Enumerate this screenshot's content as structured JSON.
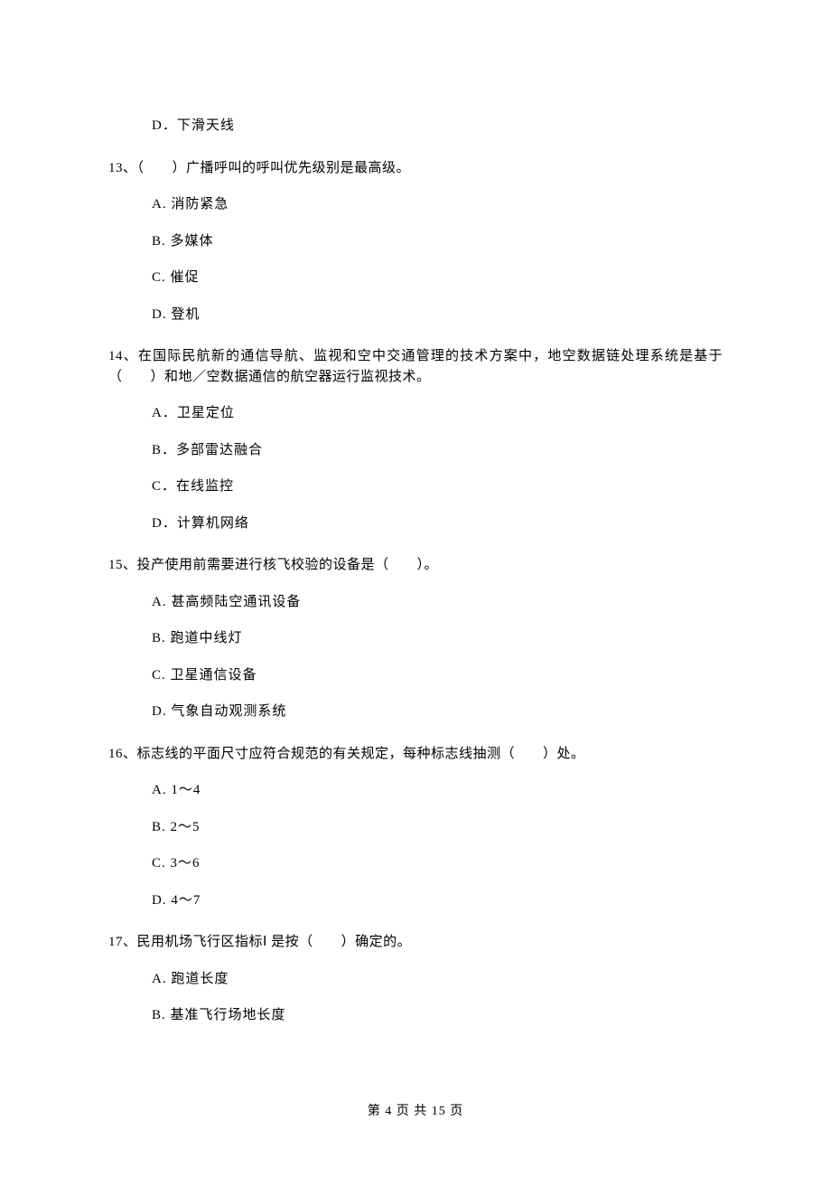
{
  "orphan_option": "D．下滑天线",
  "questions": [
    {
      "stem": "13、（　　）广播呼叫的呼叫优先级别是最高级。",
      "options": [
        "A.  消防紧急",
        "B.  多媒体",
        "C.  催促",
        "D.  登机"
      ]
    },
    {
      "stem": "14、在国际民航新的通信导航、监视和空中交通管理的技术方案中，地空数据链处理系统是基于（　　）和地／空数据通信的航空器运行监视技术。",
      "options": [
        "A．卫星定位",
        "B．多部雷达融合",
        "C．在线监控",
        "D．计算机网络"
      ]
    },
    {
      "stem": "15、投产使用前需要进行核飞校验的设备是（　　）。",
      "options": [
        "A.  甚高频陆空通讯设备",
        "B.  跑道中线灯",
        "C.  卫星通信设备",
        "D.  气象自动观测系统"
      ]
    },
    {
      "stem": "16、标志线的平面尺寸应符合规范的有关规定，每种标志线抽测（　　）处。",
      "options": [
        "A.  1～4",
        "B.  2～5",
        "C.  3～6",
        "D.  4～7"
      ]
    },
    {
      "stem": "17、民用机场飞行区指标Ⅰ 是按（　　）确定的。",
      "options": [
        "A.  跑道长度",
        "B.  基准飞行场地长度"
      ]
    }
  ],
  "footer": "第 4 页 共 15 页"
}
